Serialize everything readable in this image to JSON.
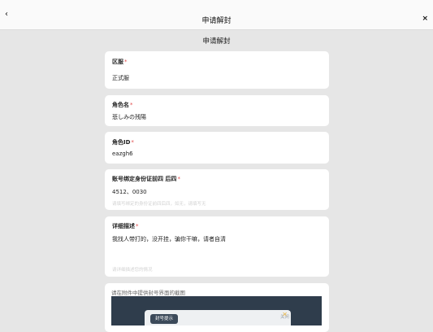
{
  "topbar": {
    "title": "申请解封"
  },
  "page": {
    "title": "申请解封"
  },
  "fields": {
    "server": {
      "label": "区服",
      "value": "正式服"
    },
    "role_name": {
      "label": "角色名",
      "value": "悲しみの残陽"
    },
    "role_id": {
      "label": "角色ID",
      "value": "eazgh6"
    },
    "id_card": {
      "label": "账号绑定身份证前四 后四",
      "value": "4512、0030",
      "placeholder": "请填写绑定的身份证前四后四，如无，请填写无"
    },
    "description": {
      "label": "详细描述",
      "value": "我找人带打的，没开挂，骗你干嘛，请者自清",
      "placeholder": "请详细描述您的情况"
    }
  },
  "attachment": {
    "label": "请在附件中提供封号界面的截图",
    "inner_tab": "封号提示",
    "inner_close": "关闭"
  },
  "colors": {
    "required": "#e14b4b",
    "background": "#e6e6e6",
    "card": "#ffffff"
  }
}
